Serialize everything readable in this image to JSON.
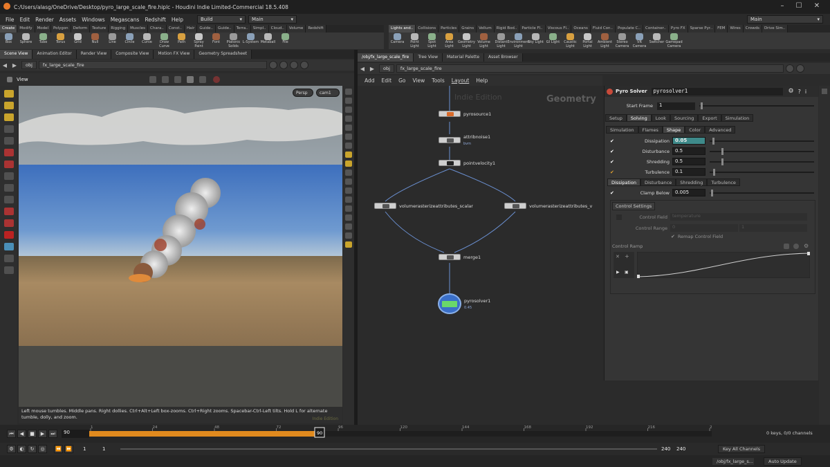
{
  "titlebar": {
    "title": "C:/Users/alasg/OneDrive/Desktop/pyro_large_scale_fire.hiplc - Houdini Indie Limited-Commercial 18.5.408"
  },
  "menu": {
    "items": [
      "File",
      "Edit",
      "Render",
      "Assets",
      "Windows",
      "Megascans",
      "Redshift",
      "Help"
    ],
    "desktop": "Build",
    "main": "Main",
    "main_right": "Main"
  },
  "shelf_tabs_left": [
    "Create",
    "Modify",
    "Model",
    "Polygon",
    "Deform",
    "Texture",
    "Rigging",
    "Muscles",
    "Chara..",
    "Const..",
    "Hair",
    "Guide..",
    "Guide..",
    "Terra..",
    "Simpl..",
    "Cloud..",
    "Volume",
    "Redshift"
  ],
  "shelf_tools_left": [
    "Box",
    "Sphere",
    "Tube",
    "Torus",
    "Grid",
    "Null",
    "Line",
    "Circle",
    "Curve",
    "Draw Curve",
    "Path",
    "Spray Paint",
    "Font",
    "Platonic Solids",
    "L-System",
    "Metaball",
    "File"
  ],
  "shelf_tabs_right": [
    "Lights and..",
    "Collisions",
    "Particles",
    "Grains",
    "Vellum",
    "Rigid Bod..",
    "Particle Fl..",
    "Viscous Fl..",
    "Oceans",
    "Fluid Con..",
    "Populate C..",
    "Container..",
    "Pyro FX",
    "Sparse Pyr..",
    "FEM",
    "Wires",
    "Crowds",
    "Drive Sim.."
  ],
  "shelf_tools_right": [
    "Camera",
    "Point Light",
    "Spot Light",
    "Area Light",
    "Geometry Light",
    "Volume Light",
    "Distant Light",
    "Environment Light",
    "Sky Light",
    "GI Light",
    "Caustic Light",
    "Portal Light",
    "Ambient Light",
    "Stereo Camera",
    "VR Camera",
    "Switcher",
    "Gamepad Camera"
  ],
  "left_pane": {
    "tabs": [
      "Scene View",
      "Animation Editor",
      "Render View",
      "Composite View",
      "Motion FX View",
      "Geometry Spreadsheet"
    ],
    "path_root": "obj",
    "path_node": "fx_large_scale_fire",
    "view_label": "View",
    "persp": "Persp",
    "cam": "cam1",
    "help_text": "Left mouse tumbles. Middle pans. Right dollies. Ctrl+Alt+Left box-zooms. Ctrl+Right zooms. Spacebar-Ctrl-Left tilts. Hold L for alternate tumble, dolly, and zoom.",
    "watermark": "Indie Edition"
  },
  "right_pane": {
    "tabs": [
      "/obj/fx_large_scale_fire",
      "Tree View",
      "Material Palette",
      "Asset Browser"
    ],
    "path_root": "obj",
    "path_node": "fx_large_scale_fire",
    "menu": [
      "Add",
      "Edit",
      "Go",
      "View",
      "Tools",
      "Layout",
      "Help"
    ],
    "watermark": "Indie Edition",
    "context_label": "Geometry"
  },
  "nodes": [
    {
      "name": "pyrosource1",
      "sub": ""
    },
    {
      "name": "attribnoise1",
      "sub": "bvm"
    },
    {
      "name": "pointvelocity1",
      "sub": ""
    },
    {
      "name": "volumerasterizeattributes_scalar",
      "sub": ""
    },
    {
      "name": "volumerasterizeattributes_v",
      "sub": ""
    },
    {
      "name": "merge1",
      "sub": ""
    },
    {
      "name": "pyrosolver1",
      "sub": "0.45"
    }
  ],
  "params": {
    "type": "Pyro Solver",
    "node": "pyrosolver1",
    "start_frame_label": "Start Frame",
    "start_frame": "1",
    "tabs1": [
      "Setup",
      "Solving",
      "Look",
      "Sourcing",
      "Export",
      "Simulation"
    ],
    "tabs2": [
      "Simulation",
      "Flames",
      "Shape",
      "Color",
      "Advanced"
    ],
    "shape": [
      {
        "label": "Dissipation",
        "value": "0.05",
        "level": 0.05
      },
      {
        "label": "Disturbance",
        "value": "0.5",
        "level": 0.5
      },
      {
        "label": "Shredding",
        "value": "0.5",
        "level": 0.5
      },
      {
        "label": "Turbulence",
        "value": "0.1",
        "level": 0.1
      }
    ],
    "tabs3": [
      "Dissipation",
      "Disturbance",
      "Shredding",
      "Turbulence"
    ],
    "clamp_below_label": "Clamp Below",
    "clamp_below": "0.005",
    "control_settings": "Control Settings",
    "control_field_label": "Control Field",
    "control_field": "temperature",
    "control_range_label": "Control Range",
    "control_range": [
      "0",
      "1"
    ],
    "remap_label": "Remap Control Field",
    "control_ramp_label": "Control Ramp"
  },
  "timeline": {
    "frame": "90",
    "current": "90",
    "ticks": [
      "1",
      "24",
      "48",
      "72",
      "96",
      "120",
      "144",
      "168",
      "192",
      "216",
      "2"
    ],
    "start": "1",
    "start2": "1",
    "end": "240",
    "end2": "240",
    "keys": "0 keys, 0/0 channels",
    "key_all": "Key All Channels"
  },
  "status": {
    "path": "/obj/fx_large_s...",
    "auto_update": "Auto Update"
  },
  "colors": {
    "orange": "#e08a1e",
    "accent": "#4a8fb8",
    "param_highlight": "#3e8a8a"
  }
}
